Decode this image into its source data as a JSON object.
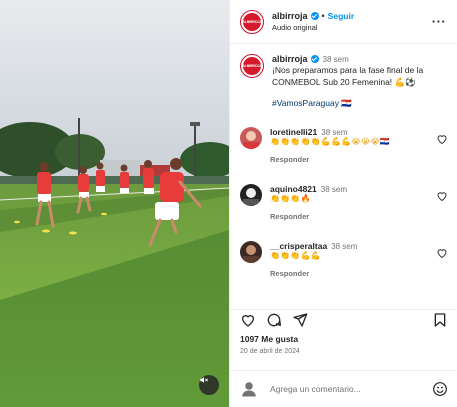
{
  "header": {
    "username": "albirroja",
    "follow_label": "Seguir",
    "audio_label": "Audio original",
    "avatar_text": "ALBIRROJA"
  },
  "caption": {
    "username": "albirroja",
    "time": "38 sem",
    "text": "¡Nos preparamos para la fase final de la CONMEBOL Sub 20 Femenina! 💪⚽",
    "hashtag": "#VamosParaguay 🇵🇾"
  },
  "comments": [
    {
      "username": "loretinelli21",
      "time": "38 sem",
      "text": "👏👏👏👏👏💪💪💪😭😭😭🇵🇾",
      "reply_label": "Responder"
    },
    {
      "username": "aquino4821",
      "time": "38 sem",
      "text": "👏👏👏🔥",
      "reply_label": "Responder"
    },
    {
      "username": "__crisperaltaa",
      "time": "38 sem",
      "text": "👏👏👏💪💪",
      "reply_label": "Responder"
    }
  ],
  "likes_text": "1097 Me gusta",
  "date_text": "20 de abril de 2024",
  "add_comment_placeholder": "Agrega un comentario...",
  "colors": {
    "accent_blue": "#0095f6",
    "brand_red": "#d7192d",
    "muted_gray": "#737373"
  },
  "icons": [
    "verified-icon",
    "more-icon",
    "heart-icon",
    "comment-icon",
    "share-icon",
    "bookmark-icon",
    "emoji-icon",
    "mute-icon",
    "profile-icon"
  ]
}
